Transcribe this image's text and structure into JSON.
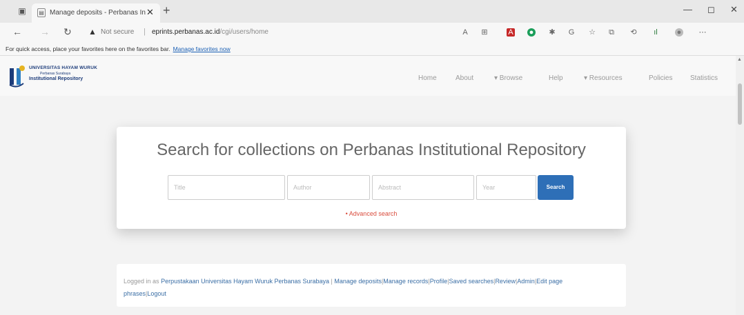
{
  "browser": {
    "tab_title": "Manage deposits - Perbanas In...",
    "close_glyph": "✕",
    "new_tab_glyph": "+",
    "window_controls": [
      "—",
      "◻",
      "✕"
    ],
    "not_secure_label": "Not secure",
    "url_host": "eprints.perbanas.ac.id",
    "url_path": "/cgi/users/home",
    "favorites_message": "For quick access, place your favorites here on the favorites bar.",
    "favorites_link": "Manage favorites now"
  },
  "site": {
    "logo_line1": "UNIVERSITAS HAYAM WURUK",
    "logo_line2": "Perbanas Surabaya",
    "logo_line3": "Institutional Repository",
    "nav": [
      "Home",
      "About",
      "▾ Browse",
      "Help",
      "▾ Resources",
      "Policies",
      "Statistics"
    ]
  },
  "search": {
    "heading": "Search for collections on Perbanas Institutional Repository",
    "title_placeholder": "Title",
    "author_placeholder": "Author",
    "abstract_placeholder": "Abstract",
    "year_placeholder": "Year",
    "button": "Search",
    "advanced": "• Advanced search"
  },
  "login": {
    "prefix": "Logged in as",
    "user": "Perpustakaan Universitas Hayam Wuruk Perbanas Surabaya",
    "sep": "|",
    "links": [
      "Manage deposits",
      "Manage records",
      "Profile",
      "Saved searches",
      "Review",
      "Admin",
      "Edit page phrases",
      "Logout"
    ]
  }
}
